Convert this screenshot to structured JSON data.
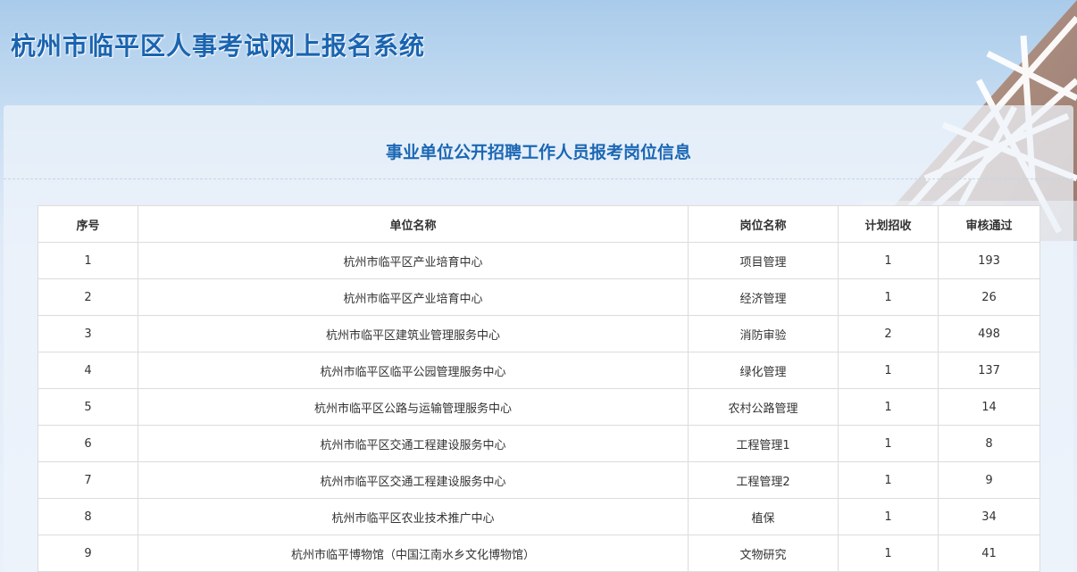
{
  "header": {
    "title": "杭州市临平区人事考试网上报名系统"
  },
  "panel": {
    "title": "事业单位公开招聘工作人员报考岗位信息"
  },
  "table": {
    "columns": [
      "序号",
      "单位名称",
      "岗位名称",
      "计划招收",
      "审核通过"
    ],
    "rows": [
      [
        "1",
        "杭州市临平区产业培育中心",
        "项目管理",
        "1",
        "193"
      ],
      [
        "2",
        "杭州市临平区产业培育中心",
        "经济管理",
        "1",
        "26"
      ],
      [
        "3",
        "杭州市临平区建筑业管理服务中心",
        "消防审验",
        "2",
        "498"
      ],
      [
        "4",
        "杭州市临平区临平公园管理服务中心",
        "绿化管理",
        "1",
        "137"
      ],
      [
        "5",
        "杭州市临平区公路与运输管理服务中心",
        "农村公路管理",
        "1",
        "14"
      ],
      [
        "6",
        "杭州市临平区交通工程建设服务中心",
        "工程管理1",
        "1",
        "8"
      ],
      [
        "7",
        "杭州市临平区交通工程建设服务中心",
        "工程管理2",
        "1",
        "9"
      ],
      [
        "8",
        "杭州市临平区农业技术推广中心",
        "植保",
        "1",
        "34"
      ],
      [
        "9",
        "杭州市临平博物馆（中国江南水乡文化博物馆）",
        "文物研究",
        "1",
        "41"
      ]
    ]
  },
  "colors": {
    "title_blue": "#1a64b0",
    "panel_title_blue": "#1b67b4"
  }
}
